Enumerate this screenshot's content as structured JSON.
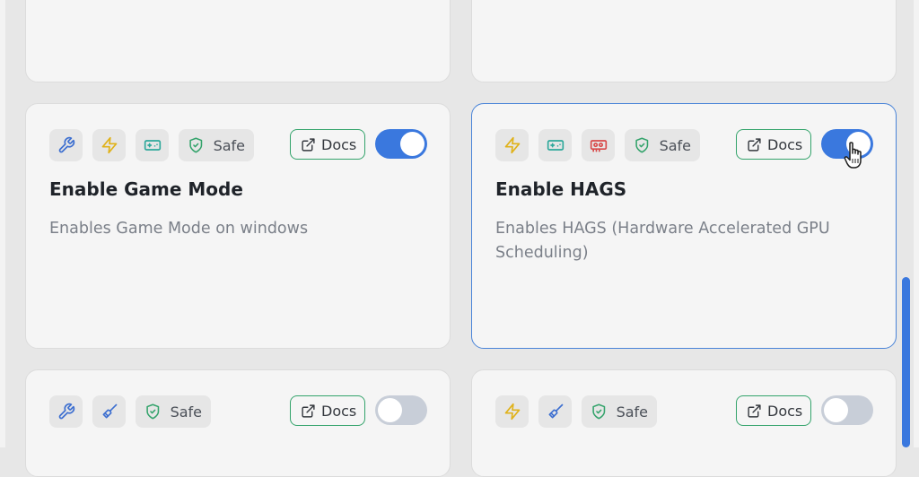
{
  "colors": {
    "accent": "#3a78de",
    "safe_green": "#33a36b",
    "wrench_blue": "#3d6fd0",
    "bolt_yellow": "#e0b21a",
    "gamepad_teal": "#2ea89b",
    "gpu_red": "#d84a4a"
  },
  "cards": [
    {
      "icons": [
        "wrench-icon",
        "bolt-icon",
        "gamepad-icon",
        "shield-check-icon"
      ],
      "safe_label": "Safe",
      "docs_label": "Docs",
      "toggle_on": true,
      "title": "Enable Game Mode",
      "description": "Enables Game Mode on windows"
    },
    {
      "icons": [
        "bolt-icon",
        "gamepad-icon",
        "gpu-icon",
        "shield-check-icon"
      ],
      "safe_label": "Safe",
      "docs_label": "Docs",
      "toggle_on": true,
      "title": "Enable HAGS",
      "description": "Enables HAGS (Hardware Accelerated GPU Scheduling)"
    },
    {
      "icons": [
        "wrench-icon",
        "broom-icon",
        "shield-check-icon"
      ],
      "safe_label": "Safe",
      "docs_label": "Docs",
      "toggle_on": false
    },
    {
      "icons": [
        "bolt-icon",
        "broom-icon",
        "shield-check-icon"
      ],
      "safe_label": "Safe",
      "docs_label": "Docs",
      "toggle_on": false
    }
  ]
}
